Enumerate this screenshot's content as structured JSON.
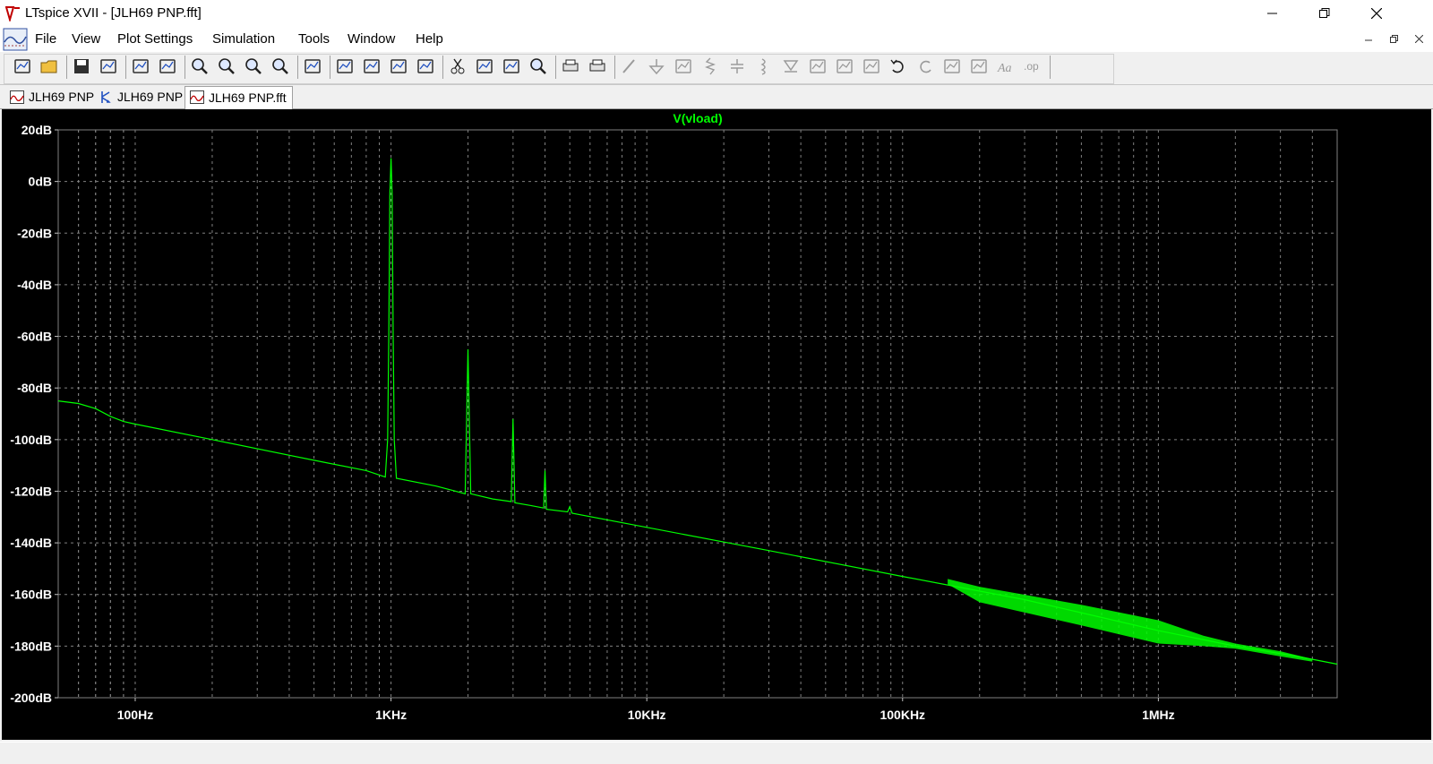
{
  "window": {
    "title": "LTspice XVII - [JLH69 PNP.fft]",
    "controls": [
      "minimize",
      "restore",
      "close"
    ]
  },
  "menu": {
    "items": [
      {
        "label": "File",
        "name": "file"
      },
      {
        "label": "View",
        "name": "view"
      },
      {
        "label": "Plot Settings",
        "name": "plot-settings"
      },
      {
        "label": "Simulation",
        "name": "simulation"
      },
      {
        "label": "Tools",
        "name": "tools"
      },
      {
        "label": "Window",
        "name": "window"
      },
      {
        "label": "Help",
        "name": "help"
      }
    ]
  },
  "toolbar": {
    "buttons": [
      "new-schematic-icon",
      "open-icon",
      "save-icon",
      "control-panel-icon",
      "run-icon",
      "halt-icon",
      "zoom-in-icon",
      "zoom-area-icon",
      "zoom-out-icon",
      "zoom-fit-icon",
      "autorange-icon",
      "plot-window-icon",
      "tile-horizontal-icon",
      "tile-vertical-icon",
      "cascade-icon",
      "cut-icon",
      "copy-icon",
      "paste-icon",
      "find-icon",
      "print-setup-icon",
      "print-icon",
      "wire-icon",
      "ground-icon",
      "label-net-icon",
      "resistor-icon",
      "capacitor-icon",
      "inductor-icon",
      "diode-icon",
      "component-icon",
      "move-icon",
      "drag-icon",
      "undo-icon",
      "redo-icon",
      "rotate-icon",
      "mirror-icon",
      "text-icon",
      "spice-directive-icon"
    ]
  },
  "tabs": [
    {
      "label": "JLH69 PNP",
      "icon": "plot-icon",
      "active": false
    },
    {
      "label": "JLH69 PNP",
      "icon": "schematic-icon",
      "active": false
    },
    {
      "label": "JLH69 PNP.fft",
      "icon": "plot-icon",
      "active": true
    }
  ],
  "colors": {
    "plot_background": "#000000",
    "trace": "#00ff00",
    "grid": "#808080",
    "axis_text": "#ffffff"
  },
  "chart_data": {
    "type": "line",
    "title": "V(vload)",
    "xlabel": "",
    "ylabel": "",
    "x_scale": "log",
    "xlim": [
      50,
      5000000
    ],
    "ylim": [
      -200,
      20
    ],
    "grid": true,
    "x_ticks": [
      {
        "value": 100,
        "label": "100Hz"
      },
      {
        "value": 1000,
        "label": "1KHz"
      },
      {
        "value": 10000,
        "label": "10KHz"
      },
      {
        "value": 100000,
        "label": "100KHz"
      },
      {
        "value": 1000000,
        "label": "1MHz"
      }
    ],
    "y_ticks": [
      {
        "value": 20,
        "label": "20dB"
      },
      {
        "value": 0,
        "label": "0dB"
      },
      {
        "value": -20,
        "label": "-20dB"
      },
      {
        "value": -40,
        "label": "-40dB"
      },
      {
        "value": -60,
        "label": "-60dB"
      },
      {
        "value": -80,
        "label": "-80dB"
      },
      {
        "value": -100,
        "label": "-100dB"
      },
      {
        "value": -120,
        "label": "-120dB"
      },
      {
        "value": -140,
        "label": "-140dB"
      },
      {
        "value": -160,
        "label": "-160dB"
      },
      {
        "value": -180,
        "label": "-180dB"
      },
      {
        "value": -200,
        "label": "-200dB"
      }
    ],
    "series": [
      {
        "name": "V(vload)",
        "points": [
          [
            50,
            -85
          ],
          [
            60,
            -86
          ],
          [
            70,
            -88
          ],
          [
            80,
            -91
          ],
          [
            90,
            -93
          ],
          [
            100,
            -94
          ],
          [
            200,
            -100
          ],
          [
            500,
            -108
          ],
          [
            800,
            -112
          ],
          [
            950,
            -114.5
          ],
          [
            970,
            -100
          ],
          [
            980,
            -60
          ],
          [
            990,
            -5
          ],
          [
            1000,
            9
          ],
          [
            1010,
            -5
          ],
          [
            1020,
            -60
          ],
          [
            1030,
            -100
          ],
          [
            1050,
            -115
          ],
          [
            1500,
            -118
          ],
          [
            1950,
            -121
          ],
          [
            2000,
            -65
          ],
          [
            2050,
            -121
          ],
          [
            2500,
            -123
          ],
          [
            2950,
            -124
          ],
          [
            3000,
            -92
          ],
          [
            3050,
            -124.5
          ],
          [
            3500,
            -125.5
          ],
          [
            3950,
            -126.5
          ],
          [
            4000,
            -112
          ],
          [
            4050,
            -127
          ],
          [
            4900,
            -128
          ],
          [
            5000,
            -126
          ],
          [
            5100,
            -128.5
          ],
          [
            10000,
            -134
          ],
          [
            30000,
            -143
          ],
          [
            100000,
            -153
          ],
          [
            300000,
            -162
          ],
          [
            1000000,
            -174
          ],
          [
            2000000,
            -180
          ],
          [
            3500000,
            -184
          ],
          [
            5000000,
            -187
          ]
        ],
        "noise_band": [
          [
            150000,
            -156,
            -154
          ],
          [
            200000,
            -163,
            -157
          ],
          [
            500000,
            -172,
            -164
          ],
          [
            1000000,
            -179,
            -170
          ],
          [
            1500000,
            -180,
            -176
          ],
          [
            2000000,
            -181,
            -179
          ],
          [
            3000000,
            -184,
            -182
          ],
          [
            4000000,
            -186,
            -185
          ]
        ]
      }
    ]
  }
}
